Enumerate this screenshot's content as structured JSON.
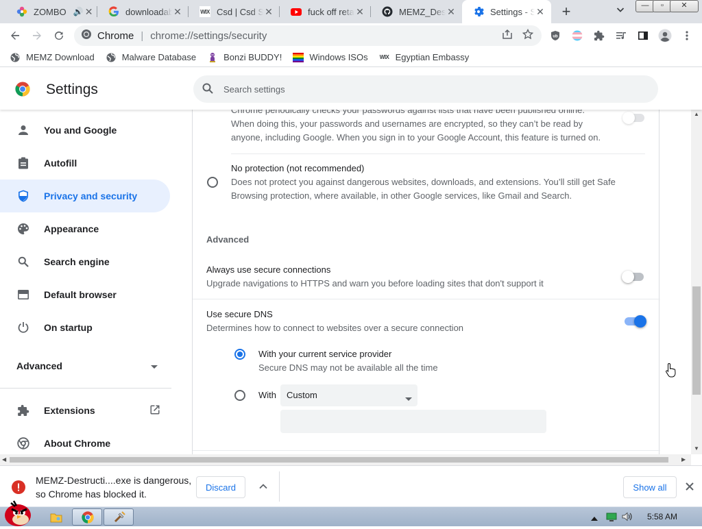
{
  "tabs": [
    {
      "title": "ZOMBO",
      "favicon": "pinwheel-icon",
      "audio": true
    },
    {
      "title": "downloadable",
      "favicon": "google-icon"
    },
    {
      "title": "Csd | Csd Se",
      "favicon": "wix-icon"
    },
    {
      "title": "fuck off retar",
      "favicon": "youtube-icon"
    },
    {
      "title": "MEMZ_Destr",
      "favicon": "github-icon"
    },
    {
      "title": "Settings - Se",
      "favicon": "settings-gear-icon",
      "active": true
    }
  ],
  "window_controls": {
    "minimize": "—",
    "maximize": "▫",
    "close": "✕"
  },
  "omnibox": {
    "site": "Chrome",
    "url": "chrome://settings/security"
  },
  "bookmarks": [
    {
      "label": "MEMZ Download",
      "icon": "globe-icon"
    },
    {
      "label": "Malware Database",
      "icon": "globe-icon"
    },
    {
      "label": "Bonzi BUDDY!",
      "icon": "bonzi-icon"
    },
    {
      "label": "Windows ISOs",
      "icon": "rainbow-flag-icon"
    },
    {
      "label": "Egyptian Embassy",
      "icon": "wix-icon"
    }
  ],
  "header": {
    "title": "Settings",
    "search_placeholder": "Search settings"
  },
  "sidebar": {
    "items": [
      {
        "label": "You and Google",
        "icon": "person-icon"
      },
      {
        "label": "Autofill",
        "icon": "clipboard-icon"
      },
      {
        "label": "Privacy and security",
        "icon": "shield-icon",
        "active": true
      },
      {
        "label": "Appearance",
        "icon": "palette-icon"
      },
      {
        "label": "Search engine",
        "icon": "search-icon"
      },
      {
        "label": "Default browser",
        "icon": "browser-icon"
      },
      {
        "label": "On startup",
        "icon": "power-icon"
      }
    ],
    "advanced": "Advanced",
    "extensions": "Extensions",
    "about": "About Chrome"
  },
  "main": {
    "leak_text_1": "Chrome periodically checks your passwords against lists that have been published online.",
    "leak_text_2": "When doing this, your passwords and usernames are encrypted, so they can’t be read by",
    "leak_text_3": "anyone, including Google. When you sign in to your Google Account, this feature is turned on.",
    "no_protection_title": "No protection (not recommended)",
    "no_protection_desc_1": "Does not protect you against dangerous websites, downloads, and extensions. You’ll still get Safe",
    "no_protection_desc_2": "Browsing protection, where available, in other Google services, like Gmail and Search.",
    "advanced_heading": "Advanced",
    "https_title": "Always use secure connections",
    "https_desc": "Upgrade navigations to HTTPS and warn you before loading sites that don't support it",
    "https_enabled": false,
    "dns_title": "Use secure DNS",
    "dns_desc": "Determines how to connect to websites over a secure connection",
    "dns_enabled": true,
    "dns_option_1_title": "With your current service provider",
    "dns_option_1_desc": "Secure DNS may not be available all the time",
    "dns_option_2_prefix": "With",
    "dns_option_2_select": "Custom"
  },
  "download_bar": {
    "message_1": "MEMZ-Destructi....exe is dangerous,",
    "message_2": "so Chrome has blocked it.",
    "discard": "Discard",
    "show_all": "Show all"
  },
  "taskbar": {
    "clock": "5:58 AM"
  },
  "colors": {
    "accent": "#1a73e8",
    "active_nav_bg": "#e8f0fe",
    "danger": "#d93025",
    "taskbar": "#a9bbd0"
  }
}
